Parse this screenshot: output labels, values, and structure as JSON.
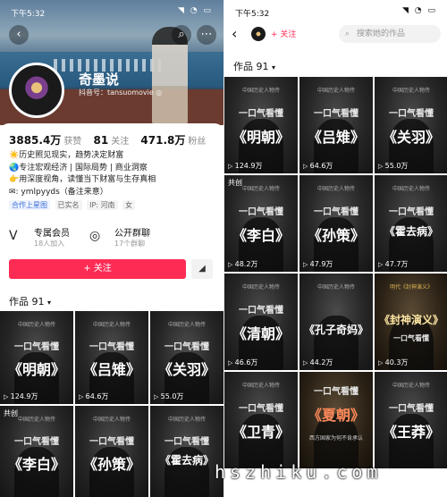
{
  "left": {
    "status": {
      "time": "下午5:32",
      "icons": "◥ ◔ ▭"
    },
    "hero_buttons": {
      "back": "‹",
      "search": "⌕",
      "more": "⋯"
    },
    "profile": {
      "nickname": "奇墨说",
      "douyin_id": "抖音号：tansuomovie ◎"
    },
    "stats": [
      {
        "value": "3885.4万",
        "label": "获赞"
      },
      {
        "value": "81",
        "label": "关注"
      },
      {
        "value": "471.8万",
        "label": "粉丝"
      }
    ],
    "bio_lines": [
      "☀️历史照见现实，趋势决定财富",
      "🌏专注宏观经济 | 国际局势 | 商业洞察",
      "👉用深度视角，读懂当下财富与生存真相",
      "✉: ymlpyyds（备注来意）"
    ],
    "tags": [
      "合作上星图",
      "已实名",
      "IP: 河南",
      "女"
    ],
    "features": [
      {
        "icon": "V",
        "title": "专属会员",
        "sub": "18人加入"
      },
      {
        "icon": "◎",
        "title": "公开群聊",
        "sub": "17个群聊"
      }
    ],
    "follow_label": "+ 关注",
    "more_label": "◢",
    "works_label": "作品 91",
    "caret": "▾",
    "tiles": [
      {
        "top": "中国历史人物传",
        "sub": "一口气看懂",
        "title": "《明朝》",
        "views": "124.9万",
        "badge": ""
      },
      {
        "top": "中国历史人物传",
        "sub": "一口气看懂",
        "title": "《吕雉》",
        "views": "64.6万",
        "badge": ""
      },
      {
        "top": "中国历史人物传",
        "sub": "一口气看懂",
        "title": "《关羽》",
        "views": "55.0万",
        "badge": ""
      },
      {
        "top": "中国历史人物传",
        "sub": "一口气看懂",
        "title": "《李白》",
        "views": "",
        "badge": "共创"
      },
      {
        "top": "中国历史人物传",
        "sub": "一口气看懂",
        "title": "《孙策》",
        "views": "",
        "badge": ""
      },
      {
        "top": "中国历史人物传",
        "sub": "一口气看懂",
        "title": "《霍去病》",
        "views": "",
        "badge": ""
      }
    ]
  },
  "right": {
    "status": {
      "time": "下午5:32",
      "icons": "◥ ◔ ▭"
    },
    "back": "‹",
    "follow_label": "+ 关注",
    "search_placeholder": "搜索她的作品",
    "search_icon": "⌕",
    "works_label": "作品 91",
    "caret": "▾",
    "tiles": [
      {
        "top": "中国历史人物传",
        "sub": "一口气看懂",
        "title": "《明朝》",
        "views": "124.9万",
        "badge": "",
        "gold": false
      },
      {
        "top": "中国历史人物传",
        "sub": "一口气看懂",
        "title": "《吕雉》",
        "views": "64.6万",
        "badge": "",
        "gold": false
      },
      {
        "top": "中国历史人物传",
        "sub": "一口气看懂",
        "title": "《关羽》",
        "views": "55.0万",
        "badge": "",
        "gold": false
      },
      {
        "top": "中国历史人物传",
        "sub": "一口气看懂",
        "title": "《李白》",
        "views": "48.2万",
        "badge": "共创",
        "gold": false
      },
      {
        "top": "中国历史人物传",
        "sub": "一口气看懂",
        "title": "《孙策》",
        "views": "47.9万",
        "badge": "",
        "gold": false
      },
      {
        "top": "中国历史人物传",
        "sub": "一口气看懂",
        "title": "《霍去病》",
        "views": "47.7万",
        "badge": "",
        "gold": false
      },
      {
        "top": "中国历史人物传",
        "sub": "一口气看懂",
        "title": "《清朝》",
        "views": "46.6万",
        "badge": "",
        "gold": false
      },
      {
        "top": "中国历史人物传",
        "sub": "",
        "title": "《孔子奇妈》",
        "views": "44.2万",
        "badge": "",
        "gold": false
      },
      {
        "top": "明代《封神演义》",
        "sub": "一口气看懂",
        "title": "《封神演义》",
        "views": "40.3万",
        "badge": "",
        "gold": true
      },
      {
        "top": "中国历史人物传",
        "sub": "一口气看懂",
        "title": "《卫青》",
        "views": "",
        "badge": "",
        "gold": false
      },
      {
        "top": "西方国家为何不肯承认",
        "sub": "一口气看懂",
        "title": "《夏朝》",
        "views": "",
        "badge": "",
        "gold": false
      },
      {
        "top": "中国历史人物传",
        "sub": "一口气看懂",
        "title": "《王莽》",
        "views": "",
        "badge": "",
        "gold": false
      }
    ]
  },
  "watermark": "hszhiku.com"
}
